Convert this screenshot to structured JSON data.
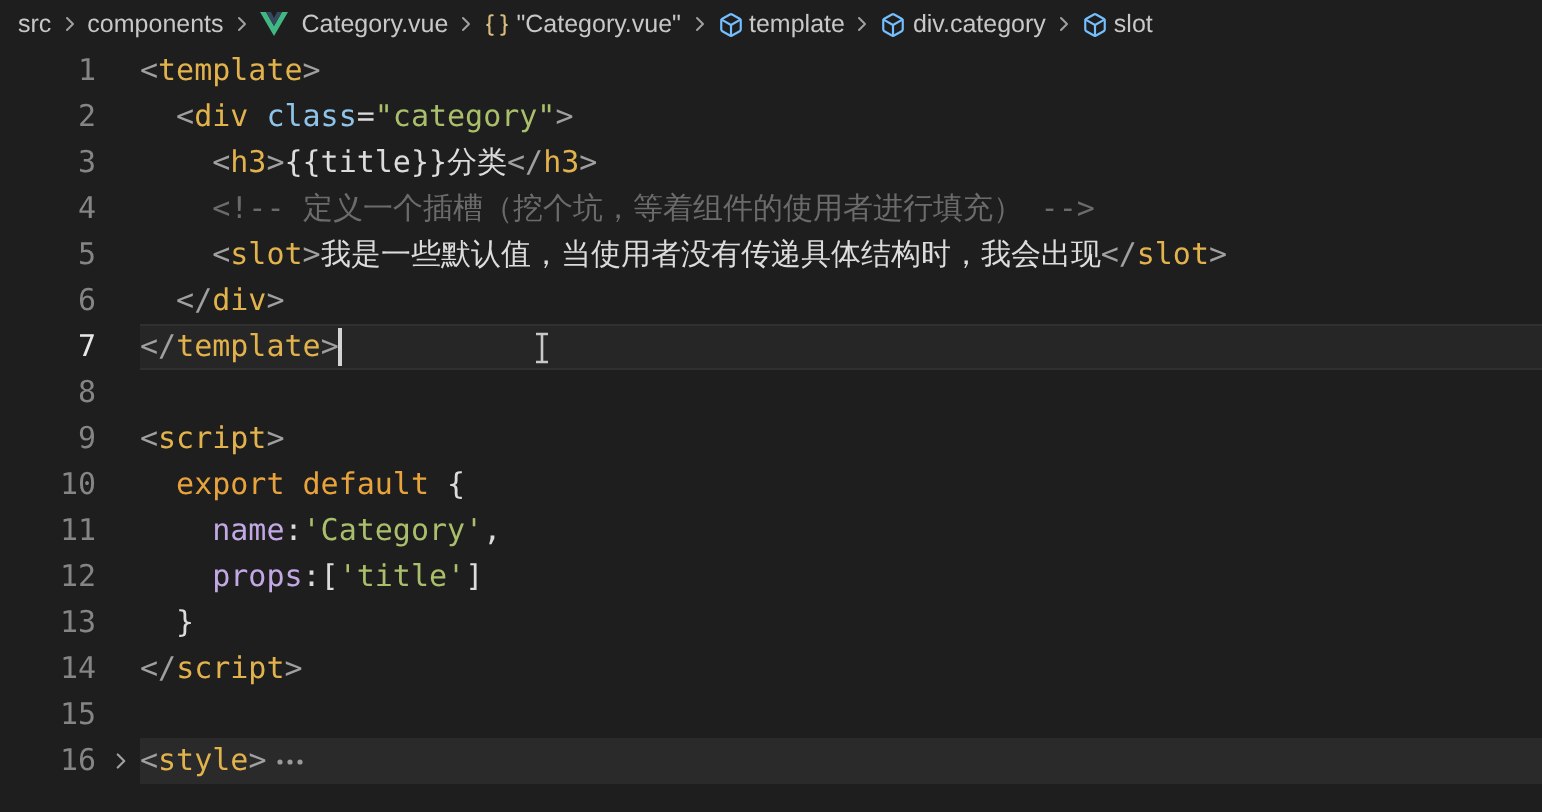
{
  "breadcrumbs": [
    {
      "kind": "folder",
      "label": "src"
    },
    {
      "kind": "folder",
      "label": "components"
    },
    {
      "kind": "vue",
      "label": "Category.vue"
    },
    {
      "kind": "object",
      "label": "\"Category.vue\""
    },
    {
      "kind": "symbol",
      "label": "template"
    },
    {
      "kind": "symbol",
      "label": "div.category"
    },
    {
      "kind": "symbol",
      "label": "slot"
    }
  ],
  "lines": [
    {
      "number": "1",
      "current": false,
      "folded": false,
      "tokens": [
        {
          "kind": "punct",
          "text": "<"
        },
        {
          "kind": "tag",
          "text": "template"
        },
        {
          "kind": "punct",
          "text": ">"
        }
      ]
    },
    {
      "number": "2",
      "current": false,
      "folded": false,
      "tokens": [
        {
          "kind": "punct",
          "text": "  <"
        },
        {
          "kind": "tag",
          "text": "div"
        },
        {
          "kind": "attr",
          "text": " class"
        },
        {
          "kind": "text",
          "text": "="
        },
        {
          "kind": "string",
          "text": "\"category\""
        },
        {
          "kind": "punct",
          "text": ">"
        }
      ]
    },
    {
      "number": "3",
      "current": false,
      "folded": false,
      "tokens": [
        {
          "kind": "punct",
          "text": "    <"
        },
        {
          "kind": "tag",
          "text": "h3"
        },
        {
          "kind": "punct",
          "text": ">"
        },
        {
          "kind": "text",
          "text": "{{title}}分类"
        },
        {
          "kind": "punct",
          "text": "</"
        },
        {
          "kind": "tag",
          "text": "h3"
        },
        {
          "kind": "punct",
          "text": ">"
        }
      ]
    },
    {
      "number": "4",
      "current": false,
      "folded": false,
      "tokens": [
        {
          "kind": "comment",
          "text": "    <!-- 定义一个插槽（挖个坑，等着组件的使用者进行填充） -->"
        }
      ]
    },
    {
      "number": "5",
      "current": false,
      "folded": false,
      "tokens": [
        {
          "kind": "punct",
          "text": "    <"
        },
        {
          "kind": "tag",
          "text": "slot"
        },
        {
          "kind": "punct",
          "text": ">"
        },
        {
          "kind": "text",
          "text": "我是一些默认值，当使用者没有传递具体结构时，我会出现"
        },
        {
          "kind": "punct",
          "text": "</"
        },
        {
          "kind": "tag",
          "text": "slot"
        },
        {
          "kind": "punct",
          "text": ">"
        }
      ]
    },
    {
      "number": "6",
      "current": false,
      "folded": false,
      "tokens": [
        {
          "kind": "punct",
          "text": "  </"
        },
        {
          "kind": "tag",
          "text": "div"
        },
        {
          "kind": "punct",
          "text": ">"
        }
      ]
    },
    {
      "number": "7",
      "current": true,
      "folded": false,
      "tokens": [
        {
          "kind": "punct",
          "text": "</"
        },
        {
          "kind": "tag",
          "text": "template"
        },
        {
          "kind": "punct",
          "text": ">"
        }
      ]
    },
    {
      "number": "8",
      "current": false,
      "folded": false
    },
    {
      "number": "9",
      "current": false,
      "folded": false,
      "tokens": [
        {
          "kind": "punct",
          "text": "<"
        },
        {
          "kind": "tag",
          "text": "script"
        },
        {
          "kind": "punct",
          "text": ">"
        }
      ]
    },
    {
      "number": "10",
      "current": false,
      "folded": false,
      "tokens": [
        {
          "kind": "keyword",
          "text": "  export default "
        },
        {
          "kind": "text",
          "text": "{"
        }
      ]
    },
    {
      "number": "11",
      "current": false,
      "folded": false,
      "tokens": [
        {
          "kind": "prop",
          "text": "    name"
        },
        {
          "kind": "text",
          "text": ":"
        },
        {
          "kind": "string",
          "text": "'Category'"
        },
        {
          "kind": "text",
          "text": ","
        }
      ]
    },
    {
      "number": "12",
      "current": false,
      "folded": false,
      "tokens": [
        {
          "kind": "prop",
          "text": "    props"
        },
        {
          "kind": "text",
          "text": ":["
        },
        {
          "kind": "string",
          "text": "'title'"
        },
        {
          "kind": "text",
          "text": "]"
        }
      ]
    },
    {
      "number": "13",
      "current": false,
      "folded": false,
      "tokens": [
        {
          "kind": "text",
          "text": "  }"
        }
      ]
    },
    {
      "number": "14",
      "current": false,
      "folded": false,
      "tokens": [
        {
          "kind": "punct",
          "text": "</"
        },
        {
          "kind": "tag",
          "text": "script"
        },
        {
          "kind": "punct",
          "text": ">"
        }
      ]
    },
    {
      "number": "15",
      "current": false,
      "folded": false
    },
    {
      "number": "16",
      "current": false,
      "folded": true,
      "tokens": [
        {
          "kind": "punct",
          "text": "<"
        },
        {
          "kind": "tag",
          "text": "style"
        },
        {
          "kind": "punct",
          "text": ">"
        }
      ]
    }
  ]
}
